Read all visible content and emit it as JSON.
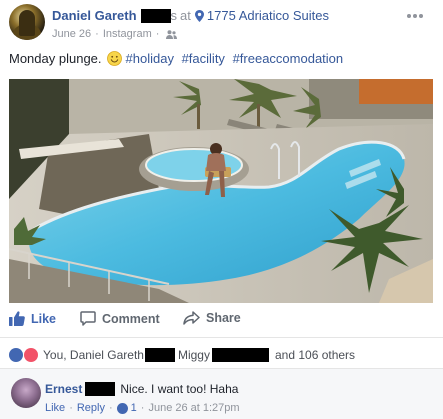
{
  "post": {
    "author": "Daniel Gareth",
    "author_suffix": "s",
    "at_text": "at",
    "place": "1775 Adriatico Suites",
    "date": "June 26",
    "source": "Instagram",
    "text": "Monday plunge.",
    "hashtags": [
      "#holiday",
      "#facility",
      "#freeaccomodation"
    ]
  },
  "actions": {
    "like": "Like",
    "comment": "Comment",
    "share": "Share"
  },
  "reactions": {
    "prefix": "You, Daniel Gareth",
    "second": "Miggy",
    "suffix": "and 106 others"
  },
  "comment": {
    "author": "Ernest",
    "text": "Nice. I want too! Haha",
    "like": "Like",
    "reply": "Reply",
    "like_count": "1",
    "time": "June 26 at 1:27pm"
  },
  "colors": {
    "link": "#365899",
    "action_blue": "#4267b2",
    "muted": "#90949c",
    "love": "#f25268"
  }
}
